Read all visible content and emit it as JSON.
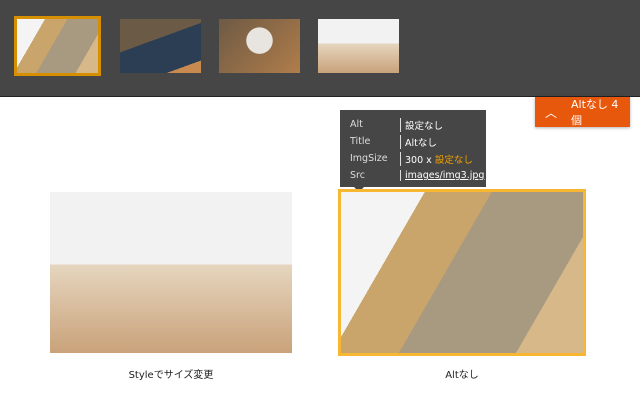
{
  "thumbnails": [
    {
      "name": "img3",
      "selected": true
    },
    {
      "name": "img2",
      "selected": false
    },
    {
      "name": "img1",
      "selected": false
    },
    {
      "name": "img4",
      "selected": false
    }
  ],
  "alt_button": {
    "icon": "chevron-up-icon",
    "label": "Altなし 4 個"
  },
  "tooltip": {
    "alt_key": "Alt",
    "alt_value": "設定なし",
    "title_key": "Title",
    "title_value": "Altなし",
    "size_key": "ImgSize",
    "size_width": "300 x",
    "size_height": "設定なし",
    "src_key": "Src",
    "src_value": "images/img3.jpg"
  },
  "images": [
    {
      "caption": "Styleでサイズ変更"
    },
    {
      "caption": "Altなし"
    }
  ],
  "colors": {
    "accent": "#e8580c",
    "highlight": "#f7b733",
    "topbar": "#464646"
  }
}
